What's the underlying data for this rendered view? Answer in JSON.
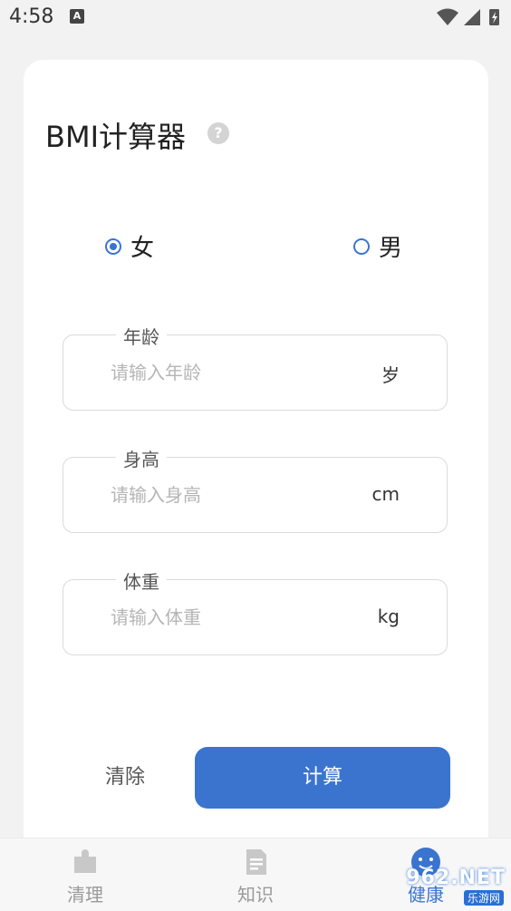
{
  "status_bar": {
    "time": "4:58",
    "notif_icon": "A"
  },
  "calculator": {
    "title": "BMI计算器",
    "help_icon": "?",
    "gender": {
      "female_label": "女",
      "male_label": "男",
      "selected": "female"
    },
    "fields": {
      "age": {
        "label": "年龄",
        "placeholder": "请输入年龄",
        "unit": "岁"
      },
      "height": {
        "label": "身高",
        "placeholder": "请输入身高",
        "unit": "cm"
      },
      "weight": {
        "label": "体重",
        "placeholder": "请输入体重",
        "unit": "kg"
      }
    },
    "clear_label": "清除",
    "calculate_label": "计算",
    "accent_color": "#3b74cf"
  },
  "bottom_nav": {
    "items": [
      {
        "label": "清理",
        "icon": "puzzle-icon"
      },
      {
        "label": "知识",
        "icon": "document-icon"
      },
      {
        "label": "健康",
        "icon": "smiley-icon"
      }
    ]
  },
  "watermark": {
    "brand": "962.NET",
    "sub": "乐游网"
  }
}
